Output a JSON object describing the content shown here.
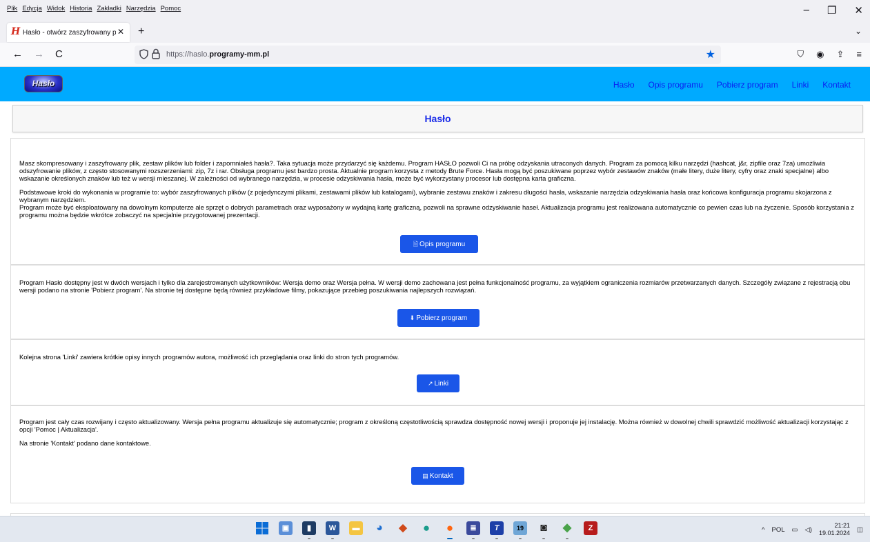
{
  "browser": {
    "menus": [
      "Plik",
      "Edycja",
      "Widok",
      "Historia",
      "Zakładki",
      "Narzędzia",
      "Pomoc"
    ],
    "window_controls": [
      "–",
      "❐",
      "✕"
    ],
    "tab": {
      "title": "Hasło - otwórz zaszyfrowany pl",
      "close": "✕",
      "favicon": "H"
    },
    "new_tab": "+",
    "list_tabs": "⌄",
    "nav": {
      "back": "←",
      "forward": "→",
      "reload": "C"
    },
    "url": {
      "prefix": "https://haslo.",
      "domain": "programy-mm.pl"
    },
    "bookmark_star": "★",
    "toolbar_icons": [
      "⛉",
      "◉",
      "⇪",
      "≡"
    ]
  },
  "site": {
    "logo_text": "Hasło",
    "nav_links": [
      "Hasło",
      "Opis programu",
      "Pobierz program",
      "Linki",
      "Kontakt"
    ],
    "page_title": "Hasło"
  },
  "sections": {
    "s1": {
      "p1": "Masz skompresowany i zaszyfrowany plik, zestaw plików lub folder i zapomniałeś hasła?. Taka sytuacja może przydarzyć się każdemu. Program HASŁO pozwoli Ci na próbę odzyskania utraconych danych. Program za pomocą kilku narzędzi (hashcat, j&r, zipfile oraz 7za) umożliwia odszyfrowanie plików, z często stosowanymi rozszerzeniami: zip, 7z i rar. Obsługa programu jest bardzo prosta. Aktualnie program korzysta z metody Brute Force. Hasła mogą być poszukiwane poprzez wybór zestawów znaków (małe litery, duże litery, cyfry oraz znaki specjalne) albo wskazanie określonych znaków lub też w wersji mieszanej. W zależności od wybranego narzędzia, w procesie odzyskiwania hasła, może być wykorzystany procesor lub dostępna karta graficzna.",
      "p2": "Podstawowe kroki do wykonania w programie to: wybór zaszyfrowanych plików (z pojedynczymi plikami, zestawami plików lub katalogami), wybranie zestawu znaków i zakresu długości hasła, wskazanie narzędzia odzyskiwania hasła oraz końcowa konfiguracja programu skojarzona z wybranym narzędziem.",
      "p3": "Program może być eksploatowany na dowolnym komputerze ale sprzęt o dobrych parametrach oraz wyposażony w wydajną kartę graficzną, pozwoli na sprawne odzyskiwanie haseł. Aktualizacja programu jest realizowana automatycznie co pewien czas lub na życzenie. Sposób korzystania z programu można będzie wkrótce zobaczyć na specjalnie przygotowanej prezentacji.",
      "button": "Opis programu"
    },
    "s2": {
      "p1": "Program Hasło dostępny jest w dwóch wersjach i tylko dla zarejestrowanych użytkowników: Wersja demo oraz Wersja pełna. W wersji demo zachowana jest pełna funkcjonalność programu, za wyjątkiem ograniczenia rozmiarów przetwarzanych danych. Szczegóły związane z rejestracją obu wersji podano na stronie 'Pobierz program'. Na stronie tej dostępne będą również przykładowe filmy, pokazujące przebieg poszukiwania najlepszych rozwiązań.",
      "button": "Pobierz program"
    },
    "s3": {
      "p1": "Kolejna strona 'Linki' zawiera krótkie opisy innych programów autora, możliwość ich przeglądania oraz linki do stron tych programów.",
      "button": "Linki"
    },
    "s4": {
      "p1": "Program jest cały czas rozwijany i często aktualizowany. Wersja pełna programu aktualizuje się automatycznie; program z określoną częstotliwością sprawdza dostępność nowej wersji i proponuje jej instalację. Można również w dowolnej chwili sprawdzić możliwość aktualizacji korzystając z opcji 'Pomoc | Aktualizacja'.",
      "p2": "Na stronie 'Kontakt' podano dane kontaktowe.",
      "button": "Kontakt"
    }
  },
  "taskbar": {
    "tray_chevron": "^",
    "language": "POL",
    "time": "21:21",
    "date": "19.01.2024"
  }
}
